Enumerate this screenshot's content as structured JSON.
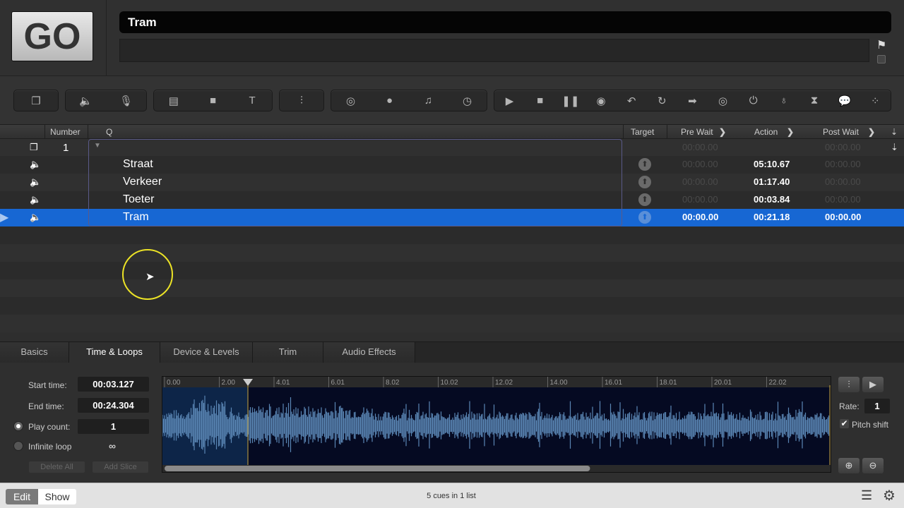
{
  "go_button": "GO",
  "cue_name": "Tram",
  "notes": "",
  "toolbar_icons": [
    [
      "group-cue-icon"
    ],
    [
      "audio-cue-icon",
      "mic-cue-icon"
    ],
    [
      "video-cue-icon",
      "camera-cue-icon",
      "text-cue-icon"
    ],
    [
      "fade-cue-icon"
    ],
    [
      "network-cue-icon",
      "midi-cue-icon",
      "music-cue-icon",
      "timecode-cue-icon"
    ],
    [
      "start-cue-icon",
      "stop-cue-icon",
      "pause-cue-icon",
      "load-cue-icon",
      "reset-cue-icon",
      "devamp-cue-icon",
      "goto-cue-icon",
      "target-cue-icon",
      "arm-cue-icon",
      "disarm-cue-icon",
      "wait-cue-icon",
      "memo-cue-icon",
      "script-cue-icon"
    ]
  ],
  "columns": {
    "number": "Number",
    "q": "Q",
    "target": "Target",
    "pre_wait": "Pre Wait",
    "action": "Action",
    "post_wait": "Post Wait"
  },
  "cues": [
    {
      "type": "group",
      "number": "1",
      "name": "",
      "pre_wait": "00:00.00",
      "action": "",
      "post_wait": "00:00.00"
    },
    {
      "type": "audio",
      "number": "",
      "name": "Straat",
      "pre_wait": "00:00.00",
      "action": "05:10.67",
      "post_wait": "00:00.00"
    },
    {
      "type": "audio",
      "number": "",
      "name": "Verkeer",
      "pre_wait": "00:00.00",
      "action": "01:17.40",
      "post_wait": "00:00.00"
    },
    {
      "type": "audio",
      "number": "",
      "name": "Toeter",
      "pre_wait": "00:00.00",
      "action": "00:03.84",
      "post_wait": "00:00.00"
    },
    {
      "type": "audio",
      "number": "",
      "name": "Tram",
      "pre_wait": "00:00.00",
      "action": "00:21.18",
      "post_wait": "00:00.00",
      "selected": true
    }
  ],
  "tabs": [
    "Basics",
    "Time & Loops",
    "Device & Levels",
    "Trim",
    "Audio Effects"
  ],
  "active_tab": "Time & Loops",
  "time_loops": {
    "start_label": "Start time:",
    "start_value": "00:03.127",
    "end_label": "End time:",
    "end_value": "00:24.304",
    "play_count_label": "Play count:",
    "play_count_value": "1",
    "infinite_label": "Infinite loop",
    "infinite_value": "∞",
    "delete_all": "Delete All",
    "add_slice": "Add Slice",
    "ruler": [
      "0.00",
      "2.00",
      "4.01",
      "6.01",
      "8.02",
      "10.02",
      "12.02",
      "14.00",
      "16.01",
      "18.01",
      "20.01",
      "22.02"
    ],
    "rate_label": "Rate:",
    "rate_value": "1",
    "pitch_label": "Pitch shift",
    "pitch_checked": true,
    "scroll_fraction": 0.64
  },
  "footer": {
    "edit": "Edit",
    "show": "Show",
    "status": "5 cues in 1 list"
  }
}
